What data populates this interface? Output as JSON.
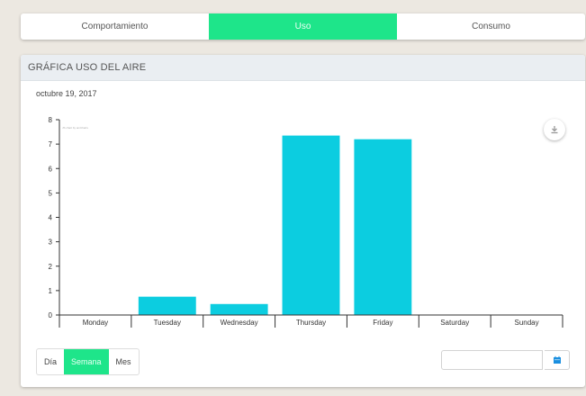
{
  "tabs": [
    {
      "label": "Comportamiento",
      "active": false
    },
    {
      "label": "Uso",
      "active": true
    },
    {
      "label": "Consumo",
      "active": false
    }
  ],
  "card": {
    "title": "GRÁFICA USO DEL AIRE",
    "date": "octubre 19, 2017",
    "credit": "JS chart by amCharts"
  },
  "period_selector": [
    {
      "label": "Día",
      "active": false
    },
    {
      "label": "Semana",
      "active": true
    },
    {
      "label": "Mes",
      "active": false
    }
  ],
  "date_input": {
    "value": "",
    "placeholder": ""
  },
  "icons": {
    "export": "download-icon",
    "calendar": "calendar-icon"
  },
  "colors": {
    "accent": "#1ee58a",
    "bar": "#0ccde0"
  },
  "chart_data": {
    "type": "bar",
    "categories": [
      "Monday",
      "Tuesday",
      "Wednesday",
      "Thursday",
      "Friday",
      "Saturday",
      "Sunday"
    ],
    "values": [
      0,
      0.75,
      0.45,
      7.35,
      7.2,
      0,
      0
    ],
    "ylim": [
      0,
      8
    ],
    "yticks": [
      0,
      1,
      2,
      3,
      4,
      5,
      6,
      7,
      8
    ],
    "grid": false,
    "title": "",
    "xlabel": "",
    "ylabel": ""
  }
}
